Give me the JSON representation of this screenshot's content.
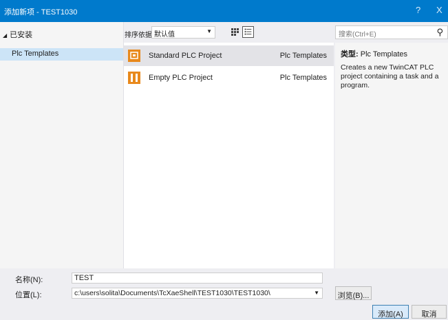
{
  "window": {
    "title": "添加新项 - TEST1030",
    "help_label": "?",
    "close_label": "X"
  },
  "tree": {
    "installed": "已安装",
    "item": "Plc Templates"
  },
  "sort": {
    "label": "排序依据:",
    "value": "默认值"
  },
  "search": {
    "placeholder": "搜索(Ctrl+E)"
  },
  "list": [
    {
      "name": "Standard PLC Project",
      "template": "Plc Templates"
    },
    {
      "name": "Empty PLC Project",
      "template": "Plc Templates"
    }
  ],
  "detail": {
    "type_label": "类型:",
    "type_value": "Plc Templates",
    "description": "Creates a new TwinCAT PLC project containing a task and a program."
  },
  "form": {
    "name_label": "名称(N):",
    "name_value": "TEST",
    "location_label": "位置(L):",
    "location_value": "c:\\users\\solita\\Documents\\TcXaeShell\\TEST1030\\TEST1030\\",
    "browse_label": "浏览(B)...",
    "add_label": "添加(A)",
    "cancel_label": "取消"
  },
  "colors": {
    "titlebar": "#007acc",
    "selection": "#cce4f7",
    "icon_orange": "#e8891c"
  }
}
